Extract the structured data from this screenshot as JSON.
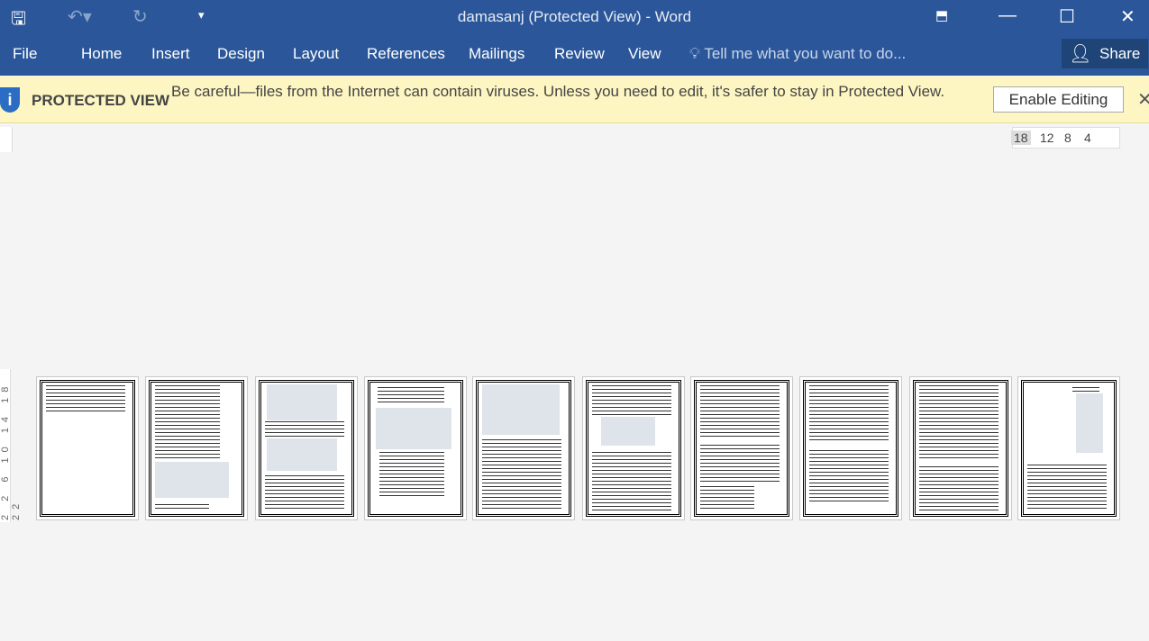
{
  "window": {
    "title": "damasanj (Protected View) - Word"
  },
  "quick_access": [
    "save-icon",
    "undo-icon",
    "redo-icon",
    "customize-icon"
  ],
  "window_controls": [
    "ribbon-display-icon",
    "minimize-icon",
    "maximize-icon",
    "close-icon"
  ],
  "ribbon": {
    "tabs": [
      "File",
      "Home",
      "Insert",
      "Design",
      "Layout",
      "References",
      "Mailings",
      "Review",
      "View"
    ],
    "tell_me": "Tell me what you want to do...",
    "share": "Share"
  },
  "protected_view": {
    "label": "PROTECTED VIEW",
    "message": "Be careful—files from the Internet can contain viruses. Unless you need to edit, it's safer to stay in Protected View.",
    "enable_button": "Enable Editing"
  },
  "ruler": {
    "horizontal": [
      "18",
      "12",
      "8",
      "4"
    ],
    "vertical": "2 2 6 10 14 18 22"
  },
  "pages": {
    "count": 10
  },
  "colors": {
    "ribbon": "#2b579a",
    "protected_bar": "#fdf6c3"
  }
}
